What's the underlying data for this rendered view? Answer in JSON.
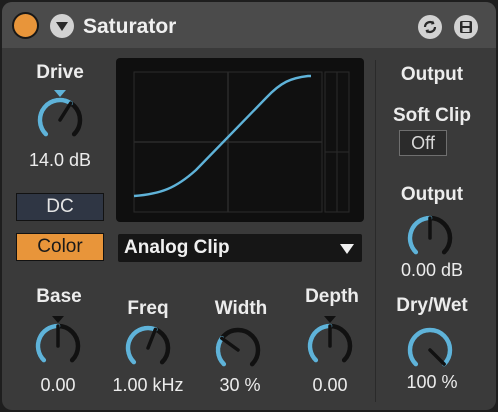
{
  "device": {
    "title": "Saturator",
    "power_on": true,
    "hotswap_icon": "hotswap-icon",
    "save_icon": "save-preset-icon"
  },
  "drive": {
    "label": "Drive",
    "value": "14.0 dB",
    "level": 0.62
  },
  "dc": {
    "label": "DC",
    "active": false
  },
  "color": {
    "label": "Color",
    "active": true
  },
  "waveshaper": {
    "selected": "Analog Clip"
  },
  "base": {
    "label": "Base",
    "value": "0.00",
    "level": 0.5
  },
  "freq": {
    "label": "Freq",
    "value": "1.00 kHz",
    "level": 0.58
  },
  "width": {
    "label": "Width",
    "value": "30 %",
    "level": 0.3
  },
  "depth": {
    "label": "Depth",
    "value": "0.00",
    "level": 0.5
  },
  "output_section": {
    "label": "Output"
  },
  "soft_clip": {
    "label": "Soft Clip",
    "value": "Off"
  },
  "output": {
    "label": "Output",
    "value": "0.00 dB",
    "level": 0.5
  },
  "drywet": {
    "label": "Dry/Wet",
    "value": "100 %",
    "level": 1.0
  },
  "colors": {
    "accent_orange": "#e8953a",
    "knob_arc": "#5fb3d9",
    "background": "#3a3a3a",
    "title_bar": "#4b4b4b"
  }
}
